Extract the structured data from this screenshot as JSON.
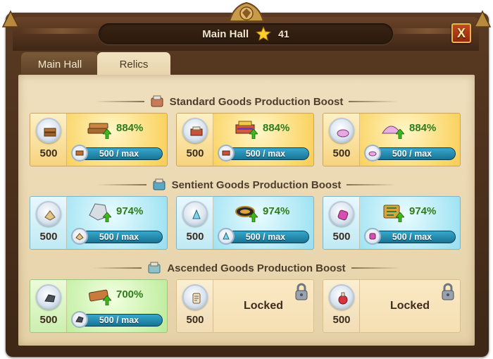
{
  "header": {
    "title": "Main Hall",
    "star_count": "41",
    "close_label": "X"
  },
  "tabs": [
    {
      "label": "Main Hall",
      "active": false
    },
    {
      "label": "Relics",
      "active": true
    }
  ],
  "sections": [
    {
      "title": "Standard Goods Production Boost",
      "cards": [
        {
          "cost": "500",
          "percent": "884%",
          "progress": "500 / max",
          "progress_fraction": 1.0,
          "good": "planks",
          "color": "yellow",
          "locked": false
        },
        {
          "cost": "500",
          "percent": "884%",
          "progress": "500 / max",
          "progress_fraction": 1.0,
          "good": "marble",
          "color": "yellow",
          "locked": false
        },
        {
          "cost": "500",
          "percent": "884%",
          "progress": "500 / max",
          "progress_fraction": 1.0,
          "good": "crystal",
          "color": "yellow",
          "locked": false
        }
      ]
    },
    {
      "title": "Sentient Goods Production Boost",
      "cards": [
        {
          "cost": "500",
          "percent": "974%",
          "progress": "500 / max",
          "progress_fraction": 1.0,
          "good": "gems",
          "color": "cyan",
          "locked": false
        },
        {
          "cost": "500",
          "percent": "974%",
          "progress": "500 / max",
          "progress_fraction": 1.0,
          "good": "elixir",
          "color": "cyan",
          "locked": false
        },
        {
          "cost": "500",
          "percent": "974%",
          "progress": "500 / max",
          "progress_fraction": 1.0,
          "good": "dust",
          "color": "cyan",
          "locked": false
        }
      ]
    },
    {
      "title": "Ascended Goods Production Boost",
      "cards": [
        {
          "cost": "500",
          "percent": "700%",
          "progress": "500 / max",
          "progress_fraction": 1.0,
          "good": "orichalcum",
          "color": "green",
          "locked": false
        },
        {
          "cost": "500",
          "locked_label": "Locked",
          "good": "scroll",
          "locked": true
        },
        {
          "cost": "500",
          "locked_label": "Locked",
          "good": "potion",
          "locked": true
        }
      ]
    }
  ],
  "colors": {
    "yellow": "#f6c84a",
    "cyan": "#9fe0f0",
    "green": "#bdeea0",
    "percent_text": "#2f7b1c"
  }
}
